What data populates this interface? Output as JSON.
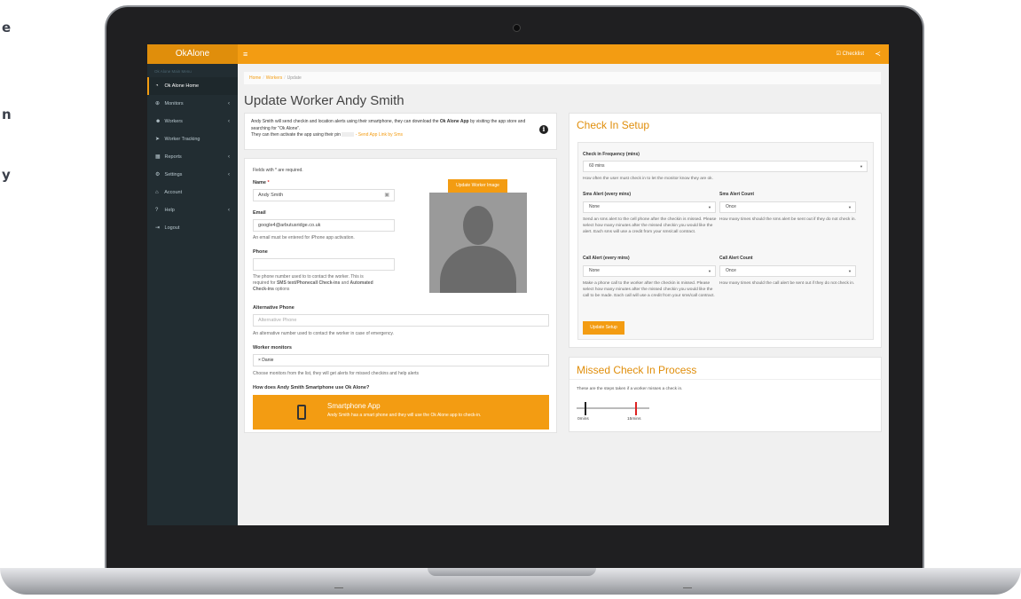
{
  "page_edge_letters": [
    "e",
    "n",
    "y"
  ],
  "topbar": {
    "brand": "OkAlone",
    "menu_toggle": "≡",
    "checklist": "☑ Checklist",
    "share_icon_glyph": "≺"
  },
  "sidebar": {
    "header": "Ok Alone Main Menu",
    "items": [
      {
        "label": "Ok Alone Home",
        "icon": "dashboard-icon",
        "glyph": "◔",
        "caret": "",
        "active": true
      },
      {
        "label": "Monitors",
        "icon": "monitor-icon",
        "glyph": "⊕",
        "caret": "‹"
      },
      {
        "label": "Workers",
        "icon": "users-icon",
        "glyph": "☻",
        "caret": "‹"
      },
      {
        "label": "Worker Tracking",
        "icon": "location-arrow-icon",
        "glyph": "➤",
        "caret": ""
      },
      {
        "label": "Reports",
        "icon": "table-icon",
        "glyph": "▦",
        "caret": "‹"
      },
      {
        "label": "Settings",
        "icon": "cogs-icon",
        "glyph": "⚙",
        "caret": "‹"
      },
      {
        "label": "Account",
        "icon": "bank-icon",
        "glyph": "⌂",
        "caret": ""
      },
      {
        "label": "Help",
        "icon": "question-icon",
        "glyph": "?",
        "caret": "‹"
      },
      {
        "label": "Logout",
        "icon": "logout-icon",
        "glyph": "⇥",
        "caret": ""
      }
    ]
  },
  "breadcrumb": {
    "home": "Home",
    "workers": "Workers",
    "current": "Update",
    "separator": "/"
  },
  "page_title": "Update Worker Andy Smith",
  "info": {
    "text_before_app": "Andy Smith will send checkin and location alerts using their smartphone, they can download the ",
    "app_name": "Ok Alone App",
    "text_after_app": " by visiting the app store and searching for \"Ok Alone\".",
    "activate_text": "They can then activate the app using their pin",
    "send_link": "- Send App Link by Sms",
    "info_glyph": "i"
  },
  "form": {
    "required_note": "Fields with * are required.",
    "name_label": "Name",
    "required_mark": "*",
    "name_value": "Andy Smith",
    "email_label": "Email",
    "email_value": "google4@arbutusridge.co.uk",
    "email_help": "An email must be entered for iPhone app activation.",
    "phone_label": "Phone",
    "phone_value": "",
    "phone_help_1": "The phone number used to to contact the worker. This is",
    "phone_help_2_prefix": "required for ",
    "phone_help_2_bold": "SMS text/Phonecall Check-ins",
    "phone_help_2_mid": " and ",
    "phone_help_2_bold2": "Automated",
    "phone_help_3_bold": "Check-ins",
    "phone_help_3_suffix": " options",
    "alt_phone_label": "Alternative Phone",
    "alt_phone_placeholder": "Alternative Phone",
    "alt_phone_help": "An alternative number used to contact the worker in case of emergency.",
    "monitors_label": "Worker monitors",
    "monitor_chip": "× Danie",
    "monitors_help": "Choose monitors from the list, they will get alerts for missed checkins and help alerts",
    "how_label": "How does Andy Smith Smartphone use Ok Alone?",
    "update_image_button": "Update Worker Image"
  },
  "smartphone": {
    "title": "Smartphone App",
    "desc": "Andy Smith has a smart phone and they will use the Ok Alone app to check-in."
  },
  "setup": {
    "title": "Check In Setup",
    "freq_label": "Check in Frequency (mins)",
    "freq_value": "60 mins",
    "freq_help": "How often the user must check in to let the monitor know they are ok.",
    "sms_alert_label": "Sms Alert (every mins)",
    "sms_alert_value": "None",
    "sms_alert_help": "Send an sms alert to the cell phone after the checkin is missed. Please select how many minutes after the missed checkin you would like the alert. Each sms will use a credit from your sms/call contract.",
    "sms_count_label": "Sms Alert Count",
    "sms_count_value": "Once",
    "sms_count_help": "How many times should the sms alert be sent out if they do not check in.",
    "call_alert_label": "Call Alert (every mins)",
    "call_alert_value": "None",
    "call_alert_help": "Make a phone call to the worker after the checkin is missed. Please select how many minutes after the missed checkin you would like the call to be made. Each call will use a credit from your sms/call contract.",
    "call_count_label": "Call Alert Count",
    "call_count_value": "Once",
    "call_count_help": "How many times should the call alert be sent out if they do not check in.",
    "button": "Update Setup",
    "select_arrow": "▼"
  },
  "missed": {
    "title": "Missed Check In Process",
    "help": "These are the steps taken if a worker misses a check in.",
    "step1": "0mins",
    "step2": "15mins"
  },
  "colors": {
    "accent": "#f39c12",
    "accent_dark": "#e08e0b",
    "sidebar": "#222d32",
    "danger": "#dd2222"
  }
}
